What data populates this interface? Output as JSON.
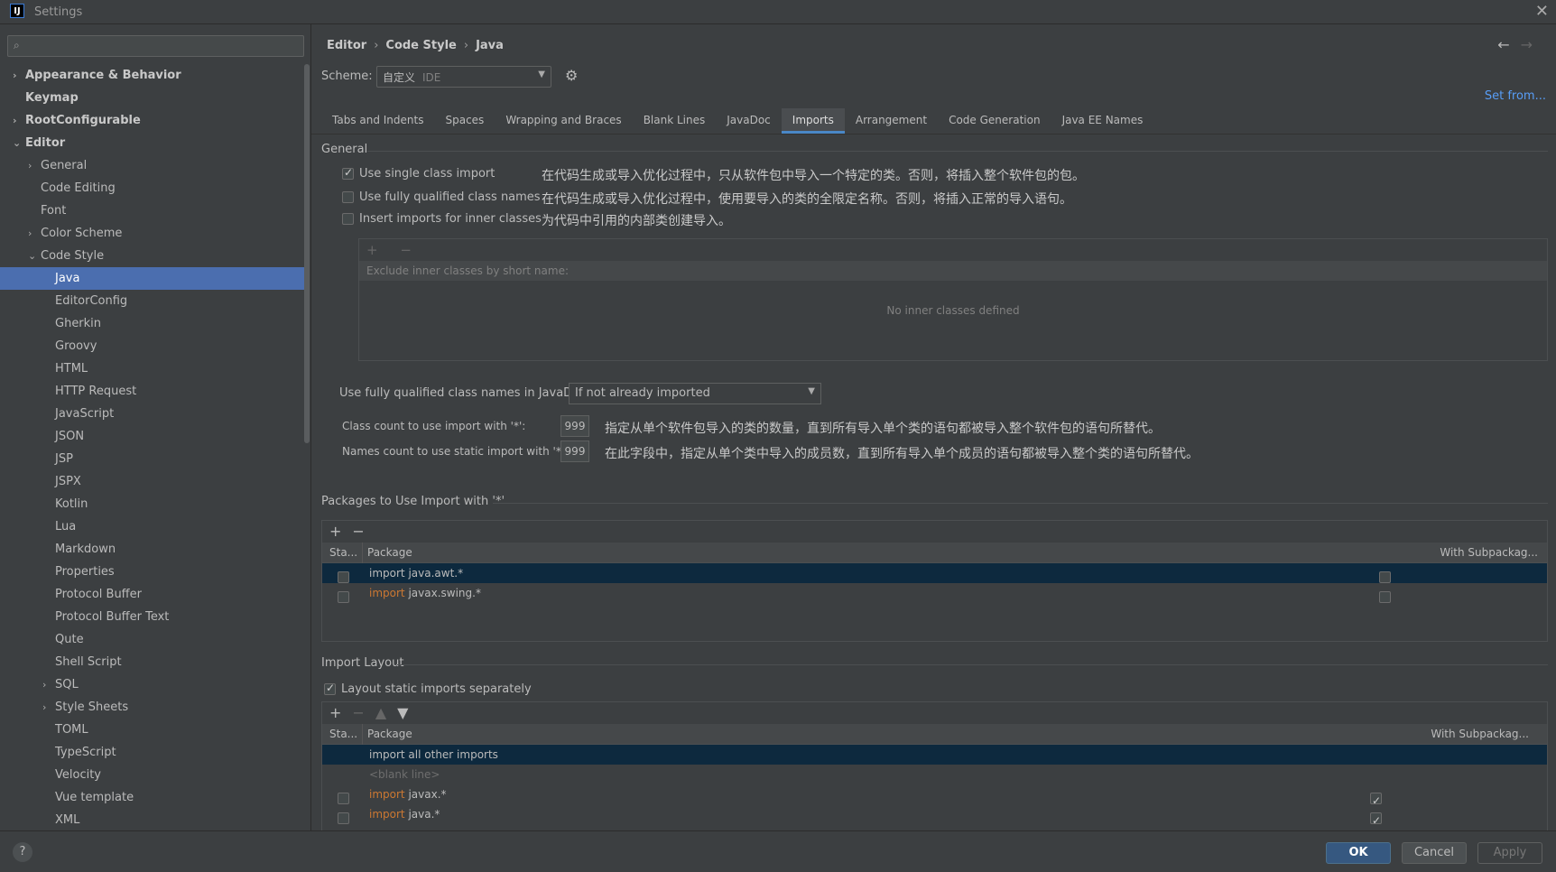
{
  "window": {
    "title": "Settings",
    "logo": "IJ"
  },
  "sidebar": {
    "search_placeholder": "",
    "items": [
      {
        "label": "Appearance & Behavior",
        "level": 0,
        "bold": true,
        "chevron": "›"
      },
      {
        "label": "Keymap",
        "level": 0,
        "bold": true,
        "chevron": ""
      },
      {
        "label": "RootConfigurable",
        "level": 0,
        "bold": true,
        "chevron": "›"
      },
      {
        "label": "Editor",
        "level": 0,
        "bold": true,
        "chevron": "⌄"
      },
      {
        "label": "General",
        "level": 1,
        "chevron": "›"
      },
      {
        "label": "Code Editing",
        "level": 1,
        "chevron": ""
      },
      {
        "label": "Font",
        "level": 1,
        "chevron": ""
      },
      {
        "label": "Color Scheme",
        "level": 1,
        "chevron": "›"
      },
      {
        "label": "Code Style",
        "level": 1,
        "chevron": "⌄"
      },
      {
        "label": "Java",
        "level": 2,
        "chevron": "",
        "selected": true
      },
      {
        "label": "EditorConfig",
        "level": 2,
        "chevron": ""
      },
      {
        "label": "Gherkin",
        "level": 2,
        "chevron": ""
      },
      {
        "label": "Groovy",
        "level": 2,
        "chevron": ""
      },
      {
        "label": "HTML",
        "level": 2,
        "chevron": ""
      },
      {
        "label": "HTTP Request",
        "level": 2,
        "chevron": ""
      },
      {
        "label": "JavaScript",
        "level": 2,
        "chevron": ""
      },
      {
        "label": "JSON",
        "level": 2,
        "chevron": ""
      },
      {
        "label": "JSP",
        "level": 2,
        "chevron": ""
      },
      {
        "label": "JSPX",
        "level": 2,
        "chevron": ""
      },
      {
        "label": "Kotlin",
        "level": 2,
        "chevron": ""
      },
      {
        "label": "Lua",
        "level": 2,
        "chevron": ""
      },
      {
        "label": "Markdown",
        "level": 2,
        "chevron": ""
      },
      {
        "label": "Properties",
        "level": 2,
        "chevron": ""
      },
      {
        "label": "Protocol Buffer",
        "level": 2,
        "chevron": ""
      },
      {
        "label": "Protocol Buffer Text",
        "level": 2,
        "chevron": ""
      },
      {
        "label": "Qute",
        "level": 2,
        "chevron": ""
      },
      {
        "label": "Shell Script",
        "level": 2,
        "chevron": ""
      },
      {
        "label": "SQL",
        "level": 2,
        "chevron": "›"
      },
      {
        "label": "Style Sheets",
        "level": 2,
        "chevron": "›"
      },
      {
        "label": "TOML",
        "level": 2,
        "chevron": ""
      },
      {
        "label": "TypeScript",
        "level": 2,
        "chevron": ""
      },
      {
        "label": "Velocity",
        "level": 2,
        "chevron": ""
      },
      {
        "label": "Vue template",
        "level": 2,
        "chevron": ""
      },
      {
        "label": "XML",
        "level": 2,
        "chevron": ""
      }
    ]
  },
  "breadcrumb": [
    "Editor",
    "Code Style",
    "Java"
  ],
  "scheme": {
    "label": "Scheme:",
    "value": "自定义",
    "suffix": "IDE"
  },
  "set_from": "Set from...",
  "tabs": [
    "Tabs and Indents",
    "Spaces",
    "Wrapping and Braces",
    "Blank Lines",
    "JavaDoc",
    "Imports",
    "Arrangement",
    "Code Generation",
    "Java EE Names"
  ],
  "active_tab": "Imports",
  "general": {
    "title": "General",
    "options": [
      {
        "label": "Use single class import",
        "checked": true,
        "desc": "在代码生成或导入优化过程中，只从软件包中导入一个特定的类。否则，将插入整个软件包的包。"
      },
      {
        "label": "Use fully qualified class names",
        "checked": false,
        "desc": "在代码生成或导入优化过程中，使用要导入的类的全限定名称。否则，将插入正常的导入语句。"
      },
      {
        "label": "Insert imports for inner classes",
        "checked": false,
        "desc": "为代码中引用的内部类创建导入。"
      }
    ],
    "inner_panel": {
      "toolbar": "+ −",
      "header": "Exclude inner classes by short name:",
      "empty": "No inner classes defined"
    },
    "javadoc_label": "Use fully qualified class names in JavaDoc:",
    "javadoc_value": "If not already imported",
    "class_count_label": "Class count to use import with '*':",
    "class_count_value": "999",
    "class_count_desc": "指定从单个软件包导入的类的数量，直到所有导入单个类的语句都被导入整个软件包的语句所替代。",
    "names_count_label": "Names count to use static import with '*':",
    "names_count_value": "999",
    "names_count_desc": "在此字段中，指定从单个类中导入的成员数，直到所有导入单个成员的语句都被导入整个类的语句所替代。"
  },
  "packages": {
    "title": "Packages to Use Import with '*'",
    "col_static": "Sta...",
    "col_package": "Package",
    "col_sub": "With Subpackag...",
    "rows": [
      {
        "kw": "import",
        "pkg": "java.awt.*",
        "selected": true
      },
      {
        "kw": "import",
        "pkg": "javax.swing.*",
        "selected": false
      }
    ]
  },
  "layout": {
    "title": "Import Layout",
    "static_sep_label": "Layout static imports separately",
    "col_static": "Sta...",
    "col_package": "Package",
    "col_sub": "With Subpackag...",
    "row_all_other": "import all other imports",
    "row_blank": "<blank line>",
    "rows": [
      {
        "kw": "import",
        "pkg": "javax.*"
      },
      {
        "kw": "import",
        "pkg": "java.*"
      }
    ]
  },
  "footer": {
    "help": "?",
    "ok": "OK",
    "cancel": "Cancel",
    "apply": "Apply"
  }
}
